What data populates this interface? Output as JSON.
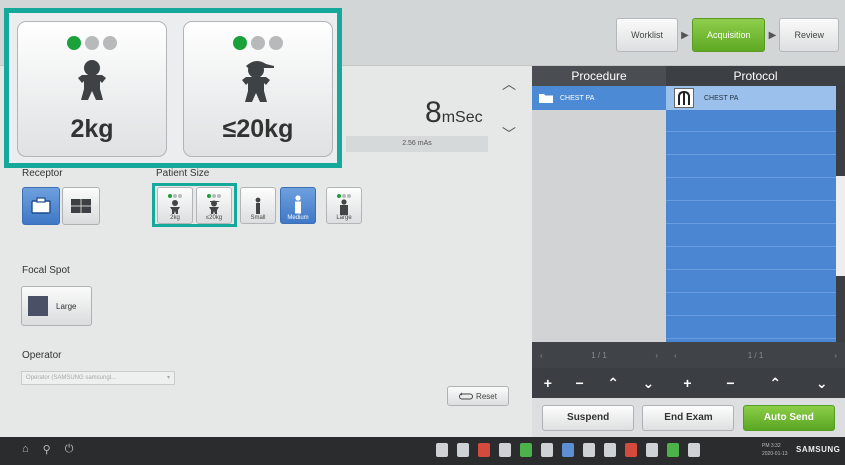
{
  "workflow": {
    "steps": [
      "Worklist",
      "Acquisition",
      "Review"
    ],
    "active": "Acquisition"
  },
  "exposure": {
    "time_value": "8",
    "time_unit": "mSec",
    "mas": "2.56 mAs"
  },
  "receptor": {
    "label": "Receptor",
    "options": [
      "detector-1",
      "detector-2"
    ],
    "selected_index": 0
  },
  "patient_size": {
    "label": "Patient Size",
    "options": [
      "2kg",
      "≤20kg",
      "Small",
      "Medium",
      "Large"
    ],
    "selected": "Medium",
    "zoom": {
      "tiles": [
        "2kg",
        "≤20kg"
      ]
    }
  },
  "focal_spot": {
    "label": "Focal Spot",
    "value": "Large"
  },
  "operator": {
    "label": "Operator",
    "value": "Operator (SAMSUNG samsungl...",
    "caret": "▾"
  },
  "reset_label": "Reset",
  "procedure": {
    "header": "Procedure",
    "items": [
      "CHEST PA"
    ],
    "pager": "1 / 1"
  },
  "protocol": {
    "header": "Protocol",
    "items": [
      "CHEST PA"
    ],
    "pager": "1 / 1"
  },
  "list_controls": [
    "+",
    "−",
    "⌃",
    "⌄"
  ],
  "actions": {
    "suspend": "Suspend",
    "end_exam": "End Exam",
    "auto_send": "Auto Send"
  },
  "taskbar": {
    "clock_time": "PM 3:32",
    "clock_date": "2020-01-13",
    "brand": "SAMSUNG"
  },
  "colors": {
    "highlight": "#14a99a",
    "accent_green": "#5ea923",
    "selected_blue": "#4c8ad6",
    "size_dot_green": "#1aa13a"
  }
}
